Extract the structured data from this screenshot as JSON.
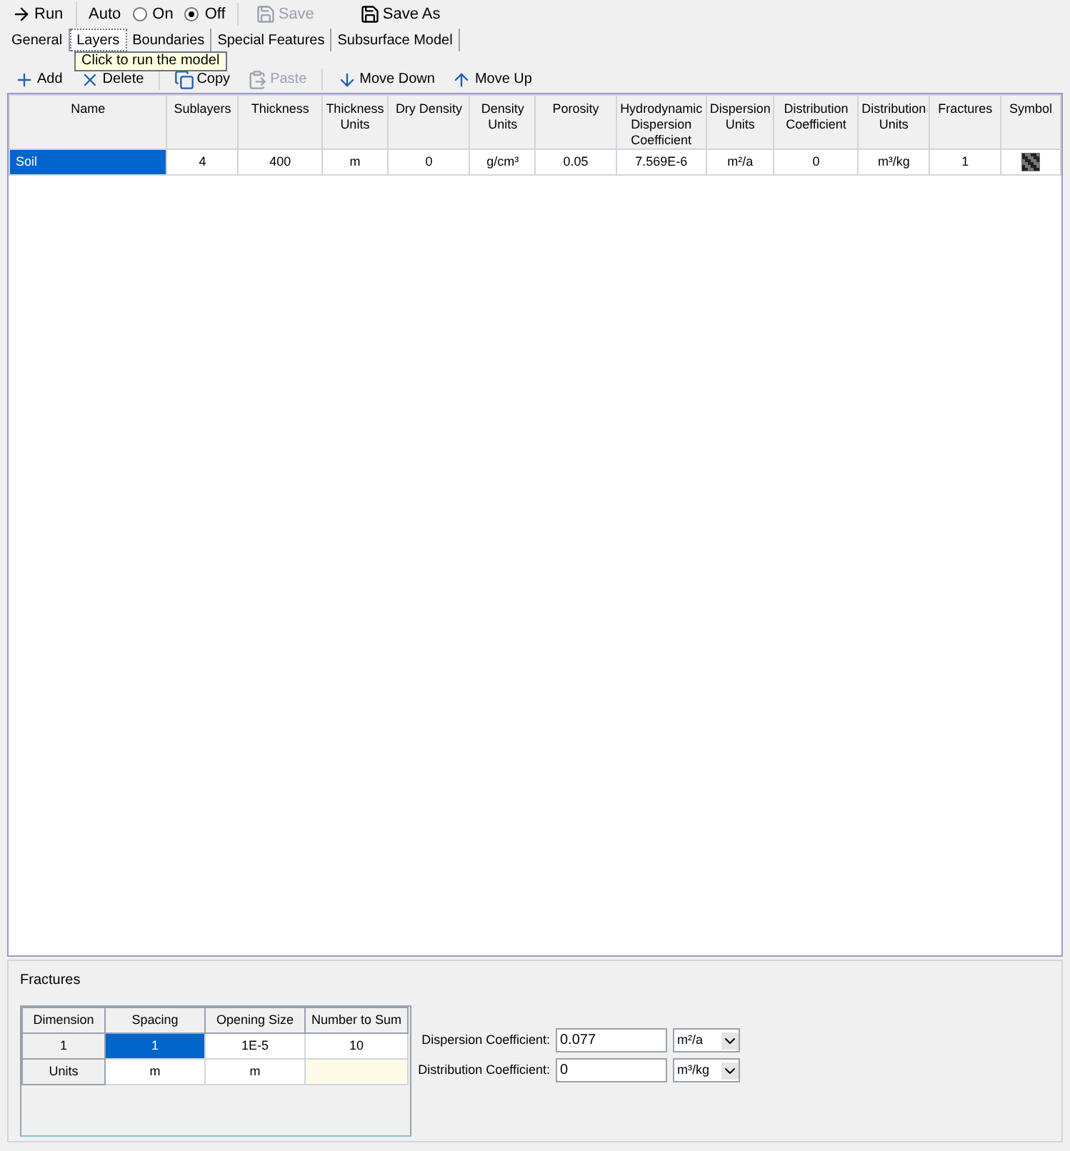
{
  "toolbar": {
    "run": "Run",
    "auto": "Auto",
    "modes": [
      {
        "label": "On",
        "selected": false
      },
      {
        "label": "Off",
        "selected": true
      }
    ],
    "save": {
      "label": "Save",
      "disabled": true
    },
    "save_as": {
      "label": "Save As",
      "disabled": false
    }
  },
  "tabs": [
    {
      "label": "General",
      "selected": false
    },
    {
      "label": "Layers",
      "selected": true
    },
    {
      "label": "Boundaries",
      "selected": false
    },
    {
      "label": "Special Features",
      "selected": false
    },
    {
      "label": "Subsurface Model",
      "selected": false
    }
  ],
  "tooltip": "Click to run the model",
  "layer_toolbar": [
    {
      "kind": "add",
      "label": "Add",
      "disabled": false
    },
    {
      "kind": "delete",
      "label": "Delete",
      "disabled": false
    },
    {
      "kind": "copy",
      "label": "Copy",
      "disabled": false
    },
    {
      "kind": "paste",
      "label": "Paste",
      "disabled": true
    },
    {
      "kind": "down",
      "label": "Move Down",
      "disabled": false
    },
    {
      "kind": "up",
      "label": "Move Up",
      "disabled": false
    }
  ],
  "layers_table": {
    "columns": [
      "Name",
      "Sublayers",
      "Thickness",
      "Thickness Units",
      "Dry Density",
      "Density Units",
      "Porosity",
      "Hydrodynamic Dispersion Coefficient",
      "Dispersion Units",
      "Distribution Coefficient",
      "Distribution Units",
      "Fractures",
      "Symbol"
    ],
    "rows": [
      {
        "selected": true,
        "cells": [
          "Soil",
          "4",
          "400",
          "m",
          "0",
          "g/cm³",
          "0.05",
          "7.569E-6",
          "m²/a",
          "0",
          "m³/kg",
          "1"
        ]
      }
    ]
  },
  "fractures": {
    "title": "Fractures",
    "columns": [
      "Dimension",
      "Spacing",
      "Opening Size",
      "Number to Sum"
    ],
    "rows": [
      {
        "cells": [
          {
            "value": "1",
            "selected": false
          },
          {
            "value": "1",
            "selected": true
          },
          {
            "value": "1E-5",
            "selected": false
          },
          {
            "value": "10",
            "selected": false
          }
        ]
      },
      {
        "cells": [
          {
            "value": "Units",
            "selected": false
          },
          {
            "value": "m",
            "selected": false
          },
          {
            "value": "m",
            "selected": false
          },
          {
            "selected": false
          }
        ]
      }
    ]
  },
  "coefficients": [
    {
      "label": "Dispersion Coefficient:",
      "value": "0.077",
      "unit": "m²/a"
    },
    {
      "label": "Distribution Coefficient:",
      "value": "0",
      "unit": "m³/kg"
    }
  ]
}
